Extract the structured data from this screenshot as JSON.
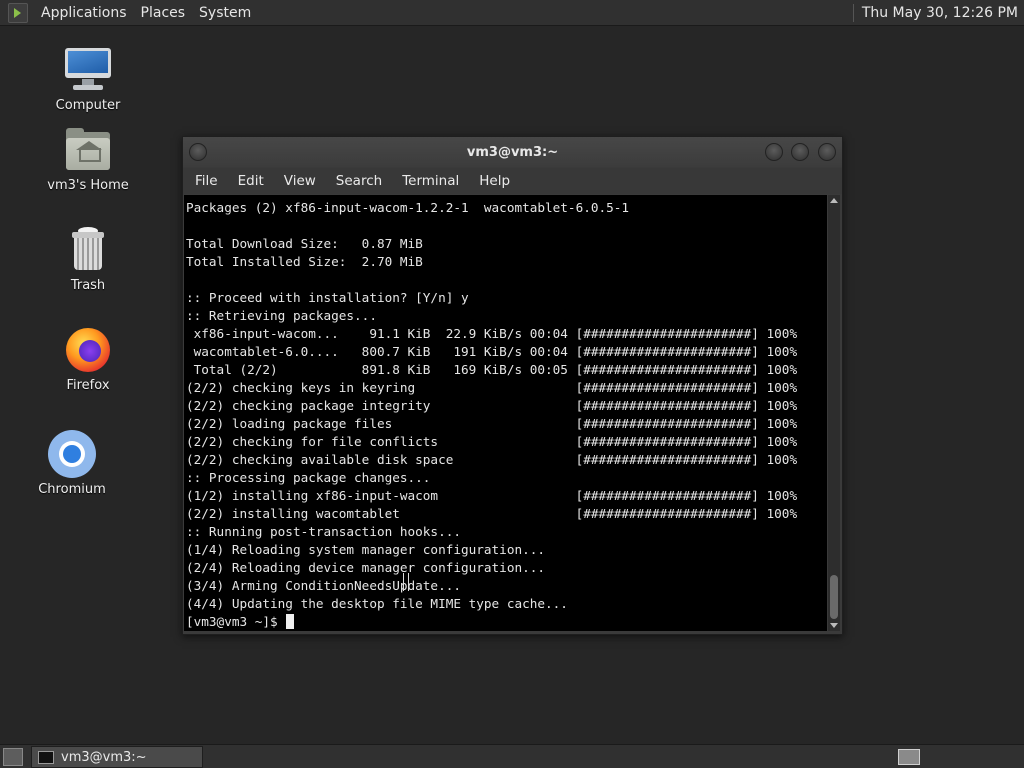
{
  "top_panel": {
    "menus": [
      "Applications",
      "Places",
      "System"
    ],
    "clock": "Thu May 30, 12:26 PM"
  },
  "desktop": {
    "icons": [
      {
        "label": "Computer",
        "icon": "computer-icon"
      },
      {
        "label": "vm3's Home",
        "icon": "home-folder-icon"
      },
      {
        "label": "Trash",
        "icon": "trash-icon"
      },
      {
        "label": "Firefox",
        "icon": "firefox-icon"
      },
      {
        "label": "Chromium",
        "icon": "chromium-icon"
      }
    ]
  },
  "terminal": {
    "title": "vm3@vm3:~",
    "menu": [
      "File",
      "Edit",
      "View",
      "Search",
      "Terminal",
      "Help"
    ],
    "lines": [
      "Packages (2) xf86-input-wacom-1.2.2-1  wacomtablet-6.0.5-1",
      "",
      "Total Download Size:   0.87 MiB",
      "Total Installed Size:  2.70 MiB",
      "",
      ":: Proceed with installation? [Y/n] y",
      ":: Retrieving packages...",
      " xf86-input-wacom...    91.1 KiB  22.9 KiB/s 00:04 [######################] 100%",
      " wacomtablet-6.0....   800.7 KiB   191 KiB/s 00:04 [######################] 100%",
      " Total (2/2)           891.8 KiB   169 KiB/s 00:05 [######################] 100%",
      "(2/2) checking keys in keyring                     [######################] 100%",
      "(2/2) checking package integrity                   [######################] 100%",
      "(2/2) loading package files                        [######################] 100%",
      "(2/2) checking for file conflicts                  [######################] 100%",
      "(2/2) checking available disk space                [######################] 100%",
      ":: Processing package changes...",
      "(1/2) installing xf86-input-wacom                  [######################] 100%",
      "(2/2) installing wacomtablet                       [######################] 100%",
      ":: Running post-transaction hooks...",
      "(1/4) Reloading system manager configuration...",
      "(2/4) Reloading device manager configuration...",
      "(3/4) Arming ConditionNeedsUpdate...",
      "(4/4) Updating the desktop file MIME type cache..."
    ],
    "prompt": "[vm3@vm3 ~]$ "
  },
  "taskbar": {
    "window_button_label": "vm3@vm3:~"
  },
  "colors": {
    "desktop_bg": "#262626",
    "panel_bg": "#303030",
    "terminal_bg": "#000000",
    "terminal_fg": "#e6e6e6"
  }
}
